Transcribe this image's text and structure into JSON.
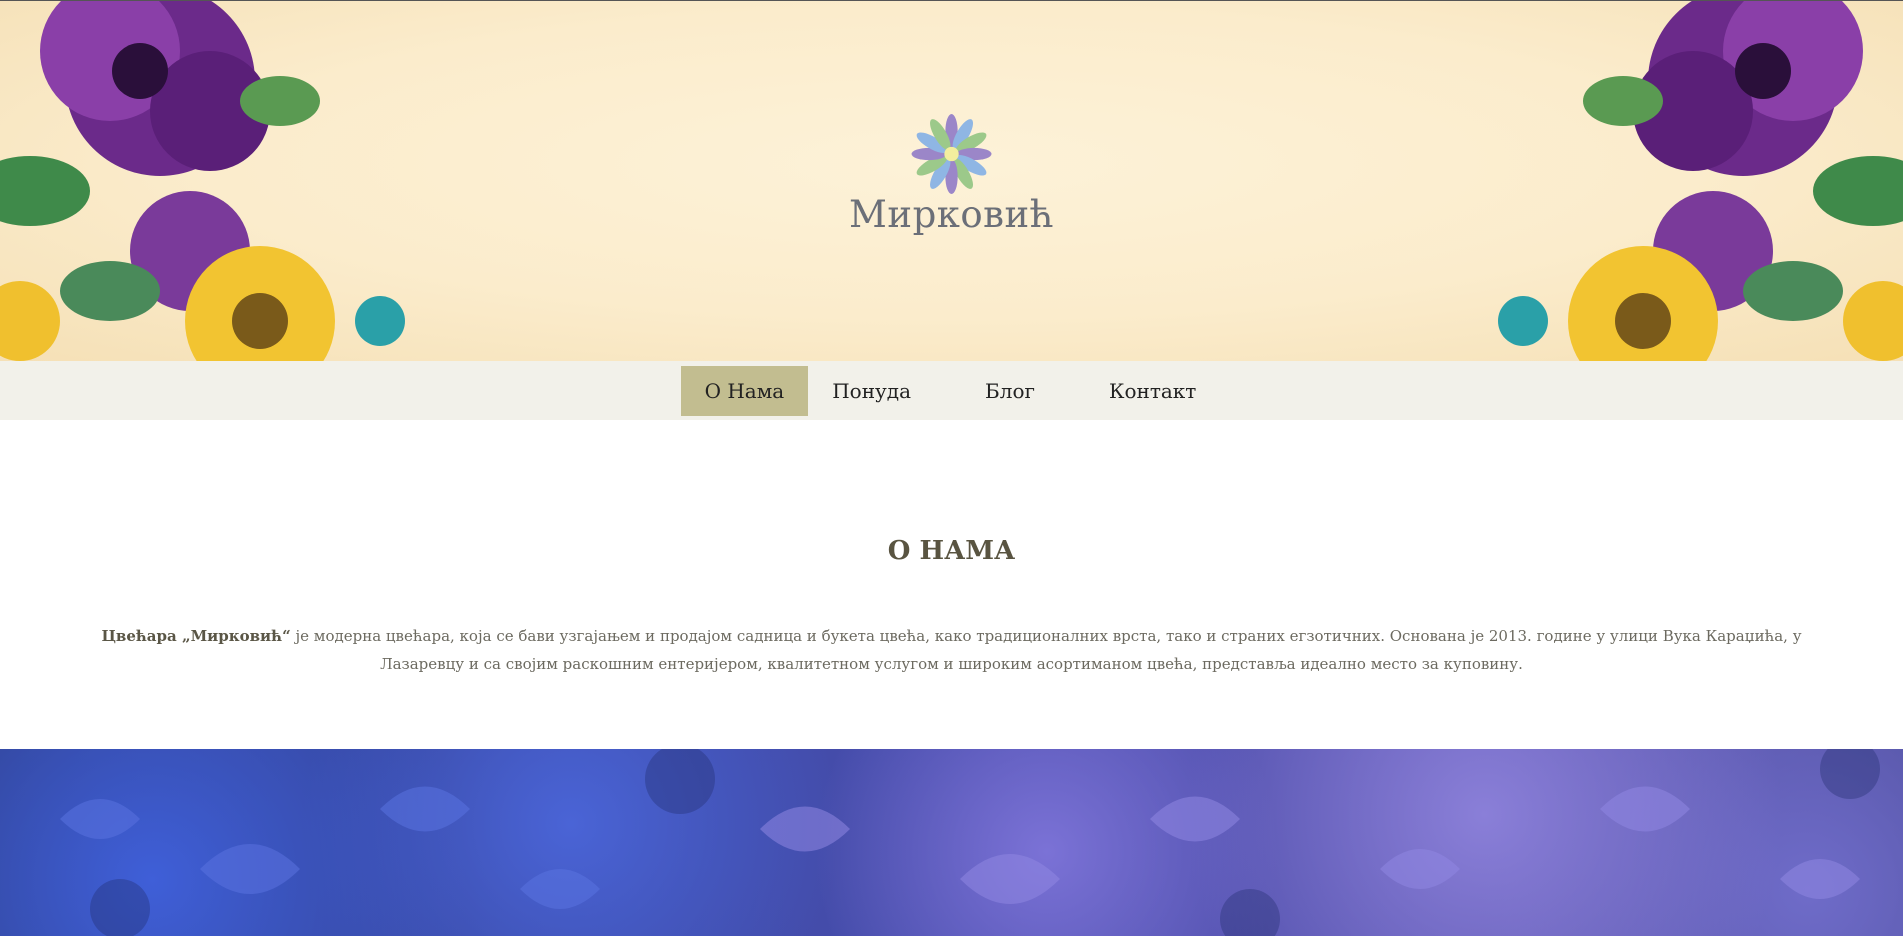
{
  "brand": {
    "name": "Мирковић"
  },
  "nav": {
    "items": [
      {
        "label": "О Нама",
        "active": true
      },
      {
        "label": "Понуда",
        "active": false
      },
      {
        "label": "Блог",
        "active": false
      },
      {
        "label": "Контакт",
        "active": false
      }
    ]
  },
  "about": {
    "title": "О НАМА",
    "text_bold": "Цвећара „Мирковић“",
    "text_rest": " је модерна цвећара, која се бави узгајањем и продајом садница и букета цвећа, како традиционалних врста, тако и страних егзотичних. Основана је 2013. године у улици Вука Караџића, у Лазаревцу и са својим раскошним ентеријером, квалитетном услугом и широким асортиманом цвећа, представља идеално место за куповину."
  },
  "colors": {
    "nav_active_bg": "#c2bd90",
    "nav_bg": "#f2f1ea",
    "title_color": "#595441",
    "logo_text": "#6b6f78"
  }
}
